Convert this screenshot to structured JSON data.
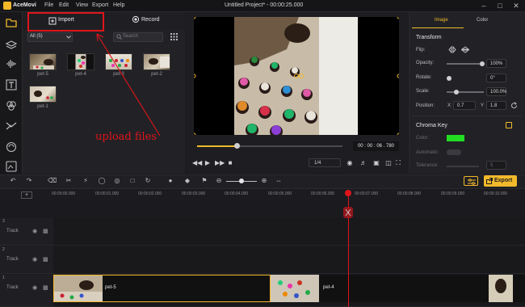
{
  "app": {
    "name": "AceMovi",
    "title": "Untitled Project* - 00:00:25.000",
    "menu": [
      "File",
      "Edit",
      "View",
      "Export",
      "Help"
    ]
  },
  "media": {
    "import_label": "Import",
    "record_label": "Record",
    "filter_value": "All (5)",
    "search_placeholder": "Search",
    "items": [
      "pet-5",
      "pet-4",
      "pet-3",
      "pet-2",
      "pet-1"
    ]
  },
  "annotation": "upload files",
  "preview": {
    "timecode": "00 : 00 : 06 . 780",
    "ratio": "1/4",
    "progress": 0.27
  },
  "props": {
    "tab_image": "Image",
    "tab_color": "Color",
    "transform_heading": "Transform",
    "flip_label": "Flip:",
    "opacity_label": "Opacity:",
    "opacity_value": "100%",
    "rotate_label": "Rotate:",
    "rotate_value": "0°",
    "scale_label": "Scale:",
    "scale_value": "100.0%",
    "position_label": "Position:",
    "x_label": "X",
    "x_value": "0.7",
    "y_label": "Y",
    "y_value": "1.8",
    "chroma_heading": "Chroma Key",
    "color_label": "Color:",
    "automatic_label": "Automatic:",
    "tolerance_label": "Tolerance:",
    "tolerance_value": "5",
    "chroma_color": "#22dd22"
  },
  "toolbar": {
    "export_label": "Export"
  },
  "ruler": [
    "00:00:00.000",
    "00:00:01.000",
    "00:00:02.000",
    "00:00:03.000",
    "00:00:04.000",
    "00:00:05.000",
    "00:00:06.000",
    "00:00:07.000",
    "00:00:08.000",
    "00:00:09.000",
    "00:00:10.000"
  ],
  "tracks": [
    {
      "num": "3",
      "label": "Track"
    },
    {
      "num": "2",
      "label": "Track"
    },
    {
      "num": "1",
      "label": "Track"
    }
  ],
  "clips": [
    {
      "label": "pet-5"
    },
    {
      "label": "pet-4"
    }
  ],
  "colors": {
    "accent": "#f2b92b",
    "annotation": "#e0141b"
  }
}
